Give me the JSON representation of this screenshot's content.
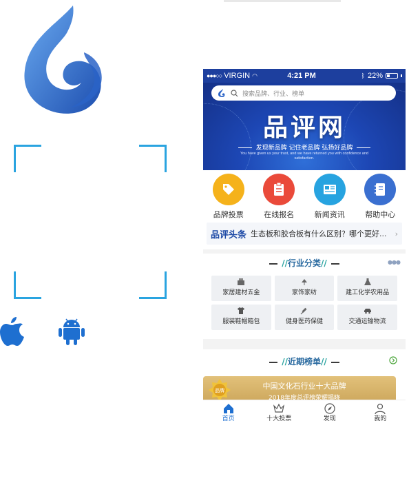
{
  "status_bar": {
    "carrier": "VIRGIN",
    "time": "4:21 PM",
    "battery": "22%"
  },
  "banner": {
    "search_placeholder": "搜索品牌、行业、榜单",
    "title": "品评网",
    "subtitle": "发现新品牌  记住老品牌  弘扬好品牌",
    "english": "You have given us your trust, and we have returned you with confidence and satisfaction."
  },
  "quick_actions": [
    {
      "label": "品牌投票",
      "icon": "tag-icon",
      "color": "#f5b21b"
    },
    {
      "label": "在线报名",
      "icon": "clipboard-icon",
      "color": "#ea4a3a"
    },
    {
      "label": "新闻资讯",
      "icon": "newspaper-icon",
      "color": "#27a3e0"
    },
    {
      "label": "帮助中心",
      "icon": "notebook-icon",
      "color": "#3a6fd0"
    }
  ],
  "headline": {
    "tag": "品评头条",
    "text": "生态板和胶合板有什么区别？哪个更好..."
  },
  "industry": {
    "title": "行业分类",
    "categories": [
      {
        "label": "家居建材五金",
        "icon": "hardware-icon"
      },
      {
        "label": "家饰家纺",
        "icon": "lamp-icon"
      },
      {
        "label": "建工化学农用品",
        "icon": "flask-icon"
      },
      {
        "label": "服装鞋帽箱包",
        "icon": "shirt-icon"
      },
      {
        "label": "健身医药保健",
        "icon": "syringe-icon"
      },
      {
        "label": "交通运输物流",
        "icon": "car-icon"
      }
    ]
  },
  "rankings": {
    "title": "近期榜单",
    "promo_title": "中国文化石行业十大品牌",
    "promo_subtitle": "2018年度总评榜荣耀揭晓",
    "badge_text": "品牌"
  },
  "tabbar": [
    {
      "label": "首页",
      "icon": "home-icon",
      "active": true
    },
    {
      "label": "十大投票",
      "icon": "crown-icon",
      "active": false
    },
    {
      "label": "发现",
      "icon": "compass-icon",
      "active": false
    },
    {
      "label": "我的",
      "icon": "user-icon",
      "active": false
    }
  ],
  "colors": {
    "brand_blue": "#1d3f9e",
    "qr_frame": "#2aa4e0",
    "apple": "#1e6fd0",
    "android": "#1e6fd0"
  }
}
